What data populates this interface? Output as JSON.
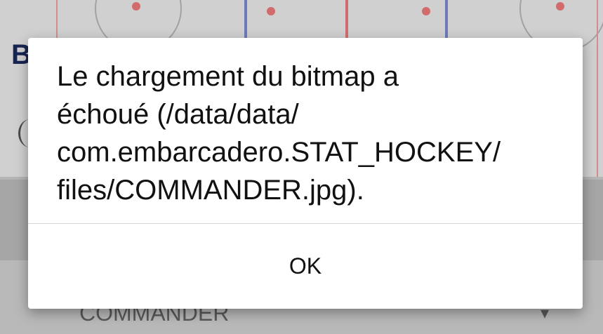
{
  "background": {
    "heading_fragment": "B",
    "dropdown_value": "COMMANDER",
    "dropdown_arrow": "▾",
    "colors": {
      "red_line": "#ef7d7d",
      "blue_line": "#7b8bd6",
      "heading": "#1c2a5e"
    }
  },
  "dialog": {
    "message": "Le chargement du bitmap a\néchoué (/data/data/\ncom.embarcadero.STAT_HOCKEY/\nfiles/COMMANDER.jpg).",
    "ok_label": "OK"
  }
}
